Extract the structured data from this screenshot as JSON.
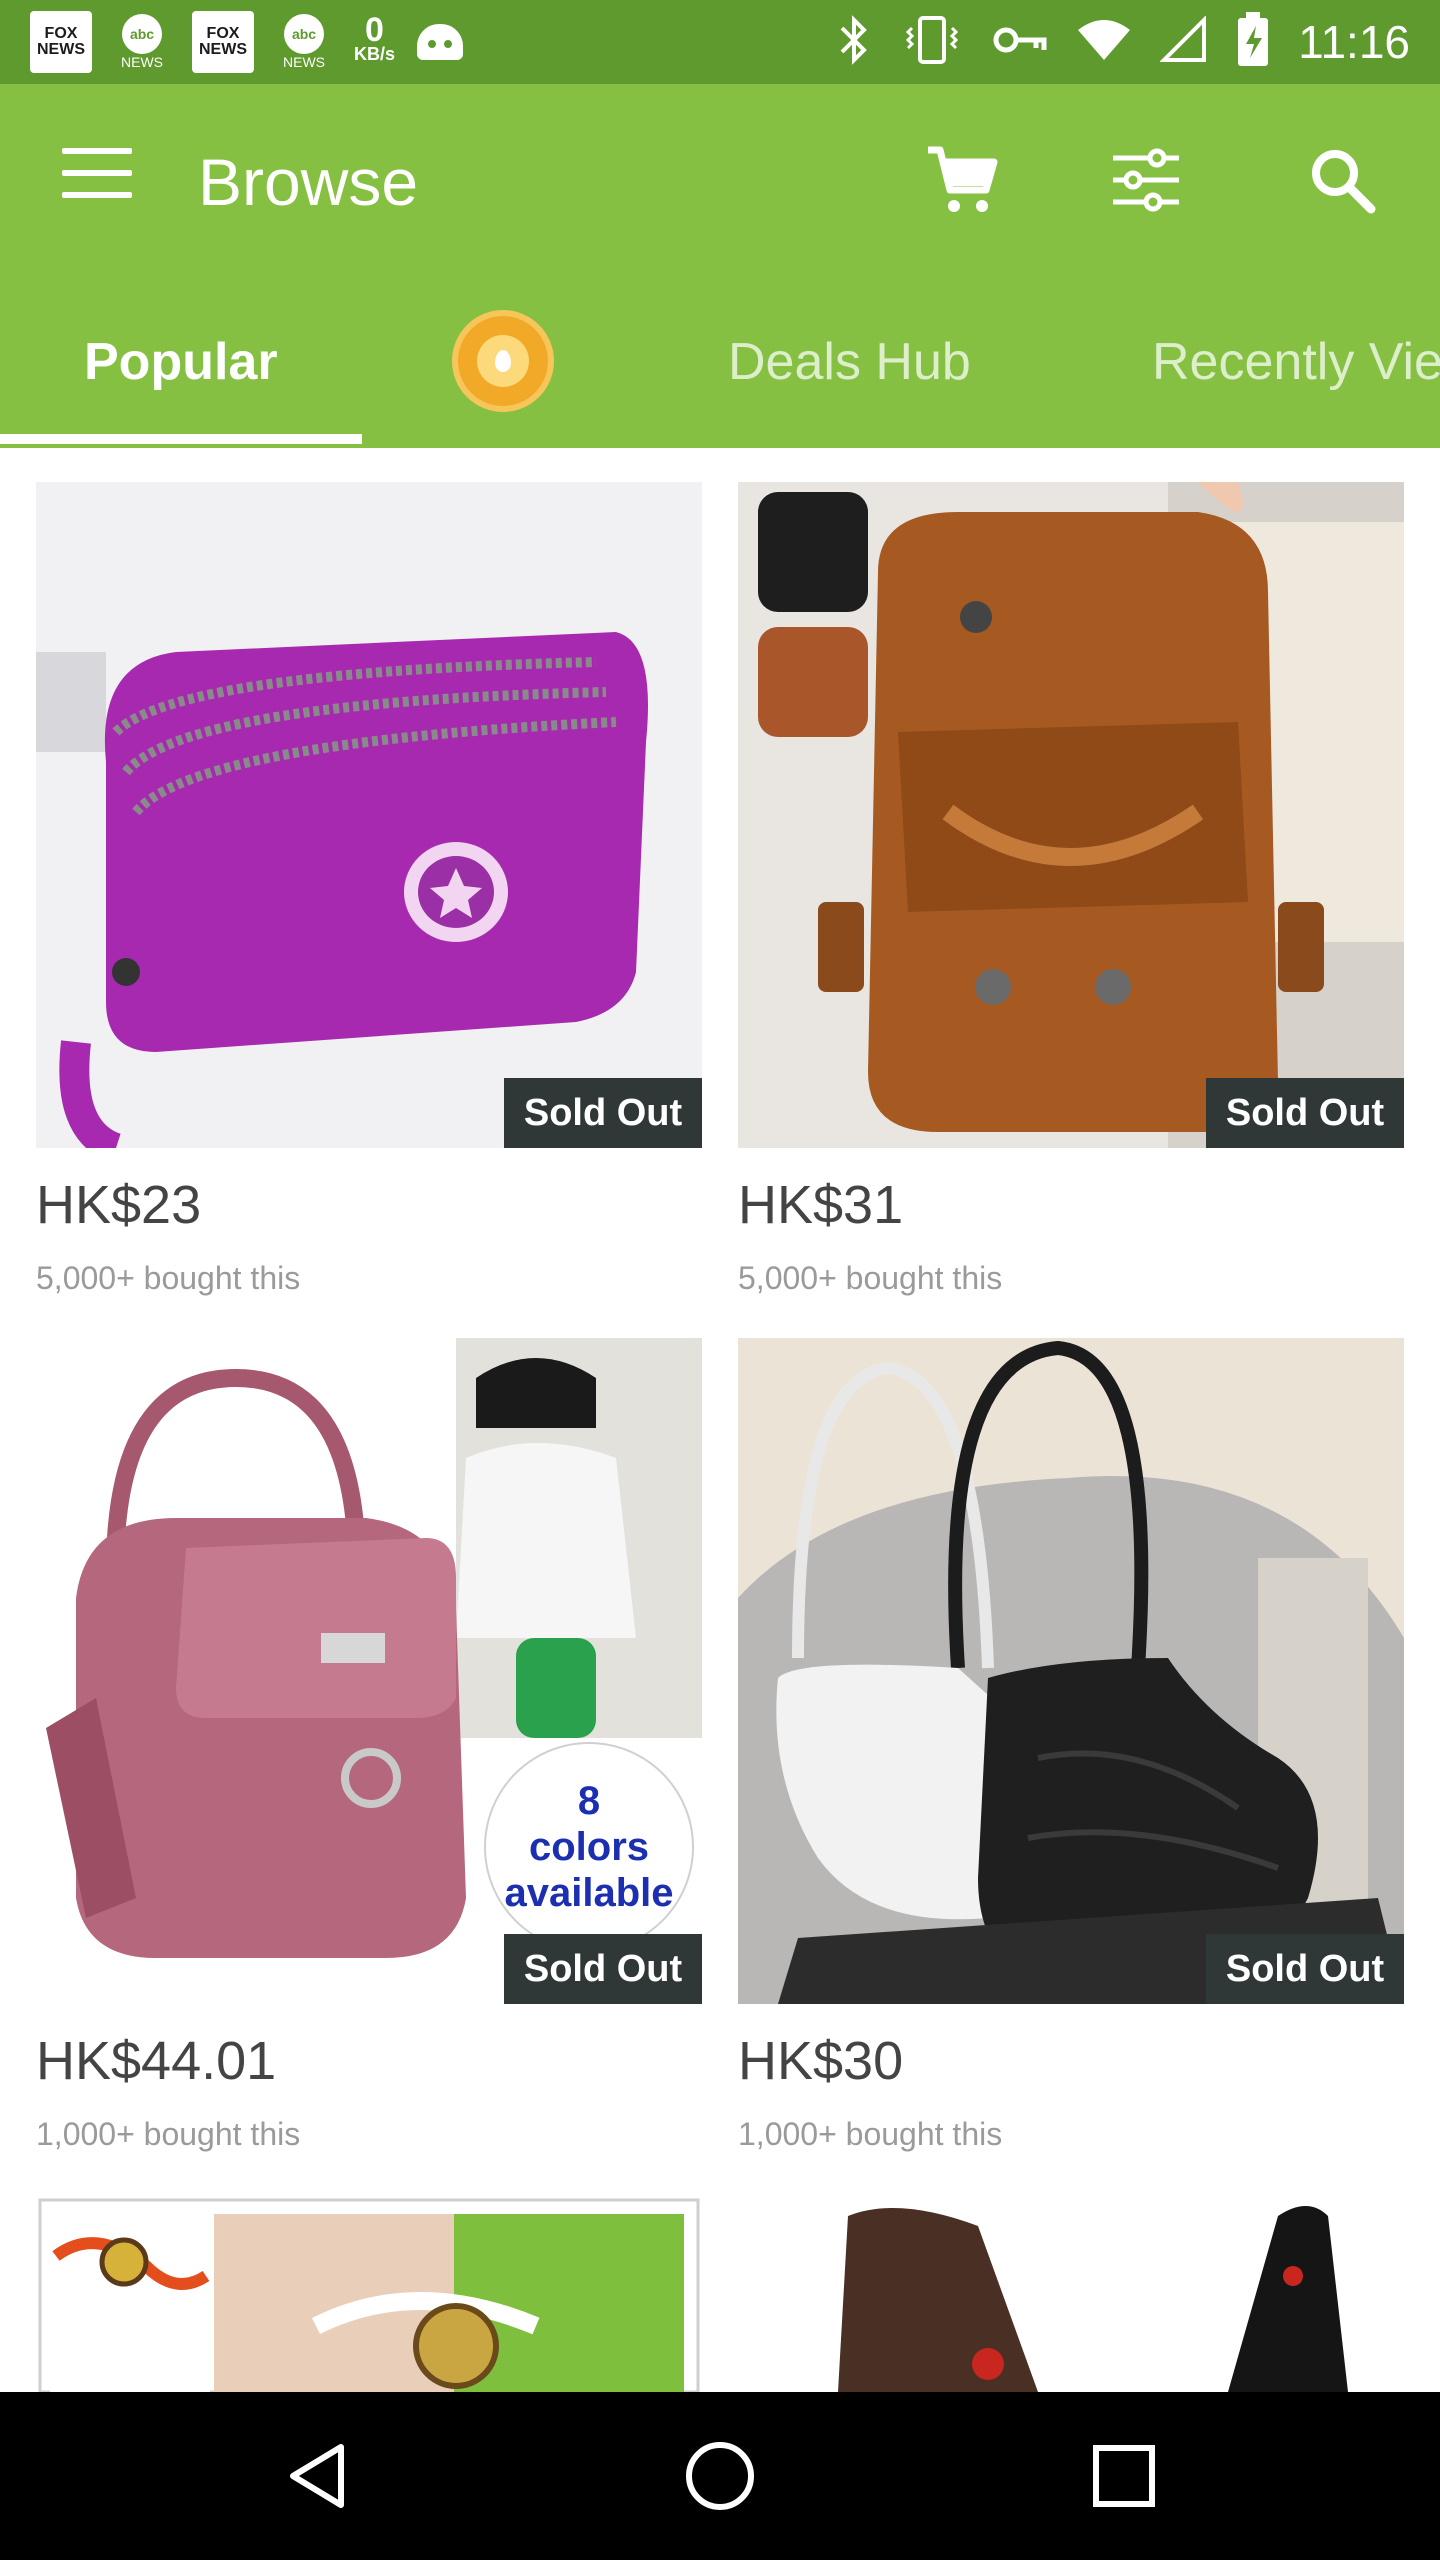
{
  "status_bar": {
    "time": "11:16",
    "notifications": [
      {
        "icon": "fox-news-icon",
        "text": "FOX NEWS"
      },
      {
        "icon": "abc-news-icon",
        "text": "abc",
        "caption": "NEWS"
      },
      {
        "icon": "fox-news-icon",
        "text": "FOX NEWS"
      },
      {
        "icon": "abc-news-icon",
        "text": "abc",
        "caption": "NEWS"
      }
    ],
    "speed_value": "0",
    "speed_unit": "KB/s"
  },
  "app_bar": {
    "title": "Browse",
    "icons": [
      "menu-icon",
      "cart-icon",
      "filter-icon",
      "search-icon"
    ]
  },
  "tabs": {
    "items": [
      "Popular",
      "Deals Hub",
      "Recently Vie"
    ],
    "active": "Popular"
  },
  "products": [
    {
      "price": "HK$23",
      "bought": "5,000+ bought this",
      "badge": "Sold Out",
      "image": "purple-zip-pouch"
    },
    {
      "price": "HK$31",
      "bought": "5,000+ bought this",
      "badge": "Sold Out",
      "image": "brown-leather-crossbody"
    },
    {
      "price": "HK$44.01",
      "bought": "1,000+ bought this",
      "badge": "Sold Out",
      "image": "mauve-mini-backpack",
      "overlay": "8\ncolors\navailable"
    },
    {
      "price": "HK$30",
      "bought": "1,000+ bought this",
      "badge": "Sold Out",
      "image": "black-white-croc-shoulder-bags"
    },
    {
      "image": "bracelet-watch-set"
    },
    {
      "image": "brown-black-sling-bags"
    }
  ],
  "colors": {
    "status_bar": "#5f9a2f",
    "app_bar": "#86c043",
    "badge": "#2f3836"
  }
}
